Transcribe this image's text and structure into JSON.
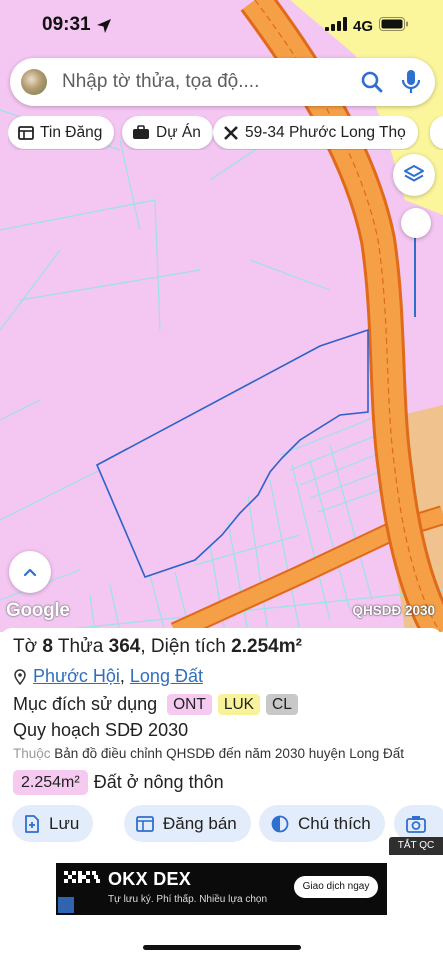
{
  "status_bar": {
    "time": "09:31",
    "network": "4G"
  },
  "search": {
    "placeholder": "Nhập tờ thửa, tọa độ...."
  },
  "chips": [
    {
      "label": "Tin Đăng",
      "icon": "news-icon"
    },
    {
      "label": "Dự Án",
      "icon": "briefcase-icon"
    },
    {
      "label": "59-34 Phước Long Thọ",
      "icon": "tools-icon"
    }
  ],
  "map": {
    "logo": "Google",
    "layer_label": "QHSDĐ 2030"
  },
  "colors": {
    "land_ont": "#f4c6f2",
    "land_luk": "#fbf59c",
    "road": "#f5a046",
    "road_outline": "#e06a1a",
    "parcel_outline": "#2e62c9",
    "plot_lines": "#9be2e6"
  },
  "parcel": {
    "sheet_label": "Tờ",
    "sheet": "8",
    "plot_label": "Thửa",
    "plot": "364",
    "area_label": "Diện tích",
    "area": "2.254m²",
    "ward": "Phước Hội",
    "district": "Long Đất",
    "purpose_label": "Mục đích sử dụng",
    "tags": [
      {
        "code": "ONT",
        "color": "#f6caf0"
      },
      {
        "code": "LUK",
        "color": "#f8f39a"
      },
      {
        "code": "CL",
        "color": "#c8c8c8"
      }
    ],
    "plan_title": "Quy hoạch SDĐ 2030",
    "belongs_prefix": "Thuộc",
    "belongs_text": "Bản đồ điều chỉnh QHSDĐ đến năm 2030 huyện Long Đất",
    "area_badge": "2.254m²",
    "land_type": "Đất ở nông thôn"
  },
  "actions": [
    {
      "label": "Lưu",
      "icon": "save-icon"
    },
    {
      "label": "Đăng bán",
      "icon": "listing-icon"
    },
    {
      "label": "Chú thích",
      "icon": "legend-icon"
    },
    {
      "label": "",
      "icon": "camera-icon"
    }
  ],
  "ad": {
    "badge": "TẮT QC",
    "title": "OKX DEX",
    "subtitle": "Tự lưu ký. Phí thấp. Nhiều lựa chọn",
    "button": "Giao dịch ngay"
  }
}
